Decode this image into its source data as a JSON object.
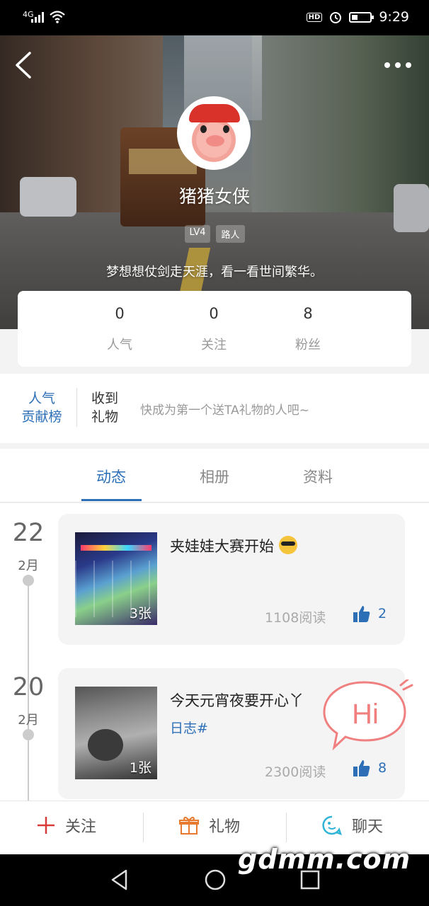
{
  "status_bar": {
    "network": "4G",
    "time": "9:29",
    "hd": "HD"
  },
  "profile": {
    "username": "猪猪女侠",
    "level": "LV4",
    "rank_title": "路人",
    "motto": "梦想想仗剑走天涯，看一看世间繁华。"
  },
  "stats": [
    {
      "value": "0",
      "label": "人气"
    },
    {
      "value": "0",
      "label": "关注"
    },
    {
      "value": "8",
      "label": "粉丝"
    }
  ],
  "gifts": {
    "rank_line1": "人气",
    "rank_line2": "贡献榜",
    "title_line1": "收到",
    "title_line2": "礼物",
    "hint": "快成为第一个送TA礼物的人吧~"
  },
  "tabs": [
    {
      "label": "动态",
      "active": true
    },
    {
      "label": "相册",
      "active": false
    },
    {
      "label": "资料",
      "active": false
    }
  ],
  "posts": [
    {
      "day": "22",
      "month": "2月",
      "title": "夹娃娃大赛开始",
      "photo_count": "3张",
      "reads": "1108阅读",
      "likes": "2",
      "tag": ""
    },
    {
      "day": "20",
      "month": "2月",
      "title": "今天元宵夜要开心丫",
      "photo_count": "1张",
      "reads": "2300阅读",
      "likes": "8",
      "tag": "日志#"
    }
  ],
  "floating": {
    "hi": "Hi"
  },
  "actions": {
    "follow": "关注",
    "gift": "礼物",
    "chat": "聊天"
  },
  "watermark": "gdmm.com",
  "colors": {
    "accent": "#2d6fb6",
    "follow_icon": "#d83a3a",
    "gift_icon": "#e77a2e",
    "chat_icon": "#2fb3d6",
    "hi_bubble": "#f08080"
  }
}
